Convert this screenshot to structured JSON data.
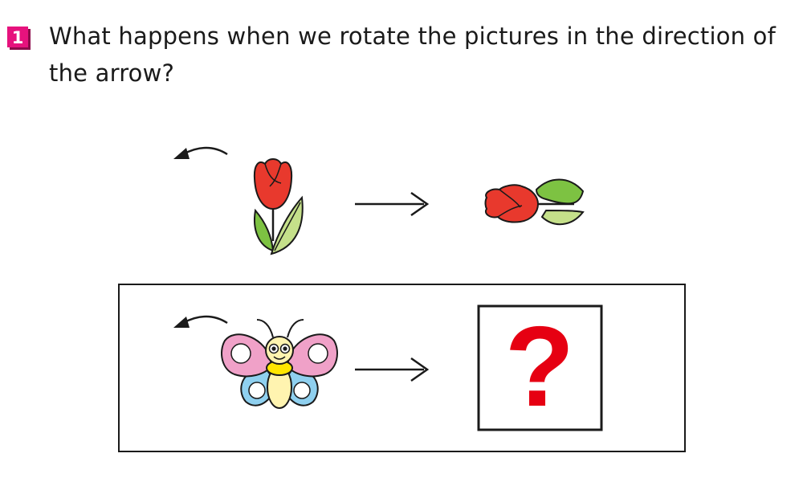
{
  "question": {
    "number": "1",
    "text": "What happens when we rotate the pictures in the direction of the arrow?"
  },
  "example": {
    "rotation": "counterclockwise",
    "angle_degrees": 90
  },
  "task": {
    "answer_mark": "?"
  },
  "colors": {
    "badge": "#e6127d",
    "badge_shadow": "#8c0a4a",
    "petal_red": "#e8392d",
    "leaf_green": "#7dc242",
    "leaf_light": "#c5e08a",
    "wing_pink": "#f0a1c8",
    "wing_blue": "#8fd0ef",
    "body_yellow": "#fff4b0",
    "collar_yellow": "#ffe600",
    "question_red": "#e60012",
    "ink": "#1a1a1a"
  }
}
